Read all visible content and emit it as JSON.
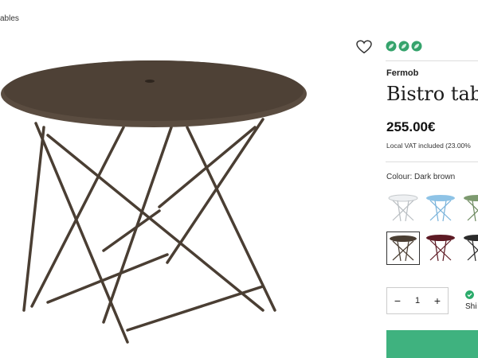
{
  "breadcrumb": {
    "text": "ables"
  },
  "product": {
    "brand": "Fermob",
    "title": "Bistro tabl",
    "price": "255.00€",
    "vat_note": "Local VAT included (23.00%",
    "colour_label": "Colour: Dark brown"
  },
  "colors": {
    "accent": "#3fb27f",
    "selected_table": "#4a3e33"
  },
  "swatches": [
    {
      "name": "white",
      "color": "#eef0f2"
    },
    {
      "name": "light-blue",
      "color": "#8ec3e6"
    },
    {
      "name": "green",
      "color": "#7d9a6f"
    },
    {
      "name": "dark-brown",
      "color": "#4a3e33",
      "selected": true
    },
    {
      "name": "burgundy",
      "color": "#5d1a24"
    },
    {
      "name": "black",
      "color": "#2b2b2b"
    }
  ],
  "quantity": {
    "minus": "−",
    "value": "1",
    "plus": "+"
  },
  "stock": {
    "text": "Shi"
  },
  "icons": {
    "wishlist": "heart-outline-icon",
    "eco": "leaf-icon",
    "stock": "check-circle-icon"
  }
}
